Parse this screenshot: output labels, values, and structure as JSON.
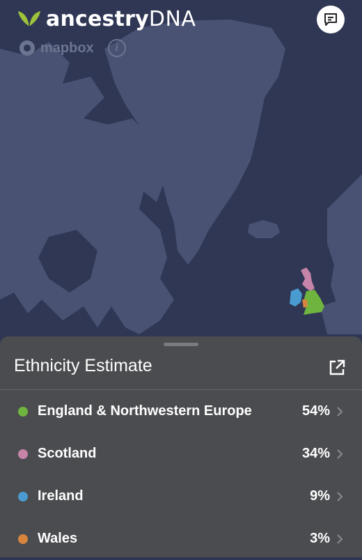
{
  "brand": {
    "name_prefix": "ancestry",
    "name_suffix": "DNA",
    "leaf_color": "#9cc33b"
  },
  "map": {
    "attribution": "mapbox",
    "ocean_color": "#2f3755",
    "land_color": "#4a5273"
  },
  "chat": {
    "icon": "chat-icon"
  },
  "panel": {
    "title": "Ethnicity Estimate",
    "external_icon": "external-link-icon",
    "regions": [
      {
        "name": "England & Northwestern Europe",
        "percent": "54%",
        "color": "#6fb43f"
      },
      {
        "name": "Scotland",
        "percent": "34%",
        "color": "#c584a8"
      },
      {
        "name": "Ireland",
        "percent": "9%",
        "color": "#4a9bd0"
      },
      {
        "name": "Wales",
        "percent": "3%",
        "color": "#d7843e"
      }
    ]
  }
}
